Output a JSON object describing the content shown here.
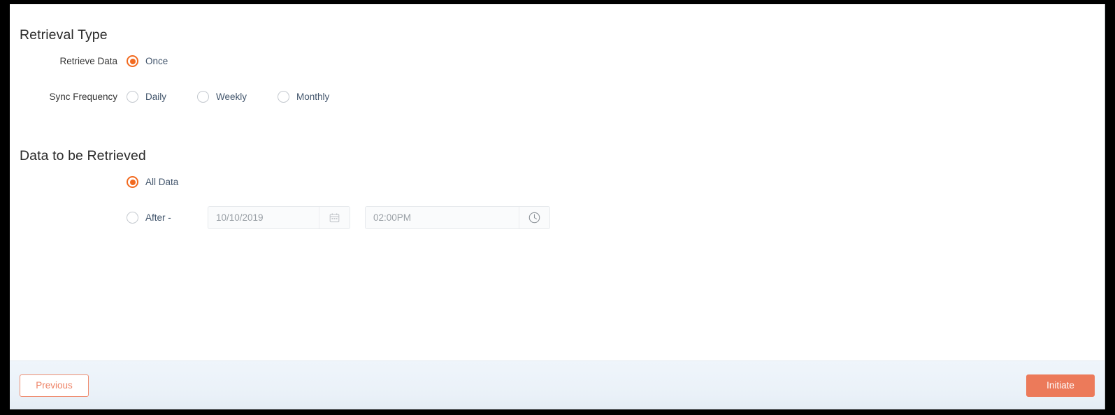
{
  "sections": {
    "retrieval_type": {
      "title": "Retrieval Type",
      "rows": {
        "retrieve_data": {
          "label": "Retrieve Data",
          "options": [
            {
              "label": "Once",
              "checked": true
            }
          ]
        },
        "sync_frequency": {
          "label": "Sync Frequency",
          "options": [
            {
              "label": "Daily",
              "checked": false
            },
            {
              "label": "Weekly",
              "checked": false
            },
            {
              "label": "Monthly",
              "checked": false
            }
          ]
        }
      }
    },
    "data_to_be_retrieved": {
      "title": "Data to be Retrieved",
      "options": [
        {
          "label": "All Data",
          "checked": true
        },
        {
          "label": "After -",
          "checked": false
        }
      ],
      "date_field": {
        "value": "10/10/2019",
        "placeholder": "10/10/2019",
        "icon": "calendar-icon"
      },
      "time_field": {
        "value": "02:00PM",
        "placeholder": "02:00PM",
        "icon": "clock-icon"
      }
    }
  },
  "footer": {
    "previous_label": "Previous",
    "initiate_label": "Initiate"
  },
  "colors": {
    "accent_orange": "#f26b21",
    "button_orange": "#ec7a5a",
    "button_orange_border": "#ef8e72",
    "footer_bg": "#eff5fb",
    "label_text": "#333333",
    "option_text": "#41546b",
    "input_text": "#9aa0a6"
  }
}
